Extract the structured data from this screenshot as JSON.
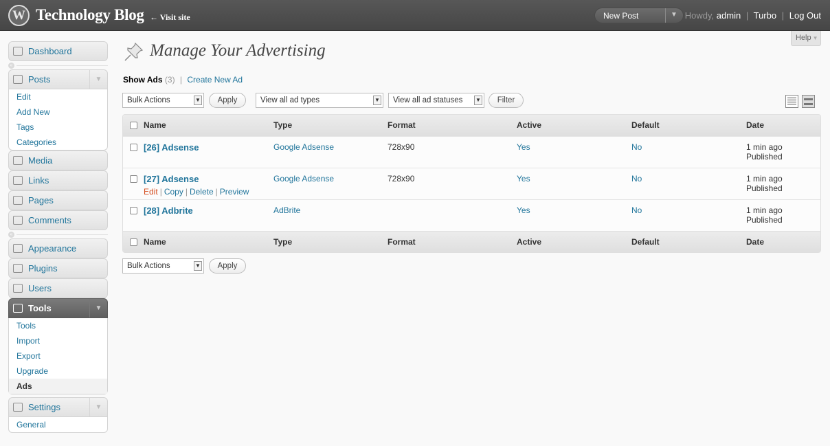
{
  "header": {
    "site_title": "Technology Blog",
    "visit_site": "← Visit site",
    "new_post": "New Post",
    "howdy": "Howdy,",
    "username": "admin",
    "turbo": "Turbo",
    "logout": "Log Out"
  },
  "help": "Help",
  "sidebar": {
    "dashboard": "Dashboard",
    "posts": "Posts",
    "posts_sub": [
      "Edit",
      "Add New",
      "Tags",
      "Categories"
    ],
    "media": "Media",
    "links": "Links",
    "pages": "Pages",
    "comments": "Comments",
    "appearance": "Appearance",
    "plugins": "Plugins",
    "users": "Users",
    "tools": "Tools",
    "tools_sub": [
      "Tools",
      "Import",
      "Export",
      "Upgrade",
      "Ads"
    ],
    "settings": "Settings",
    "settings_sub": [
      "General"
    ]
  },
  "page": {
    "title": "Manage Your Advertising",
    "show_ads": "Show Ads",
    "count": "(3)",
    "create_new": "Create New Ad"
  },
  "filters": {
    "bulk_actions": "Bulk Actions",
    "apply": "Apply",
    "ad_types": "View all ad types",
    "ad_statuses": "View all ad statuses",
    "filter": "Filter"
  },
  "table": {
    "columns": [
      "Name",
      "Type",
      "Format",
      "Active",
      "Default",
      "Date"
    ],
    "rows": [
      {
        "name": "[26] Adsense",
        "type": "Google Adsense",
        "format": "728x90",
        "active": "Yes",
        "default": "No",
        "date": "1 min ago",
        "status": "Published"
      },
      {
        "name": "[27] Adsense",
        "type": "Google Adsense",
        "format": "728x90",
        "active": "Yes",
        "default": "No",
        "date": "1 min ago",
        "status": "Published"
      },
      {
        "name": "[28] Adbrite",
        "type": "AdBrite",
        "format": "",
        "active": "Yes",
        "default": "No",
        "date": "1 min ago",
        "status": "Published"
      }
    ],
    "row_actions": {
      "edit": "Edit",
      "copy": "Copy",
      "delete": "Delete",
      "preview": "Preview"
    }
  },
  "colors": {
    "link": "#21759b",
    "header_bg": "#464646",
    "edit_link": "#d54e21"
  }
}
